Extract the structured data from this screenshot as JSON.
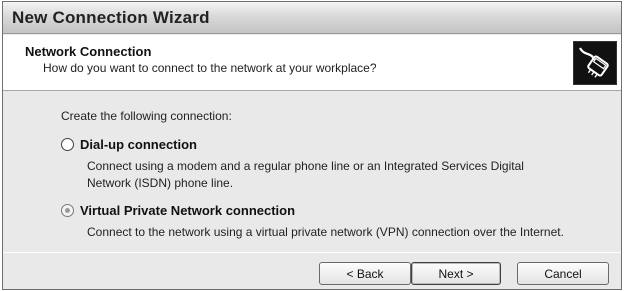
{
  "window": {
    "title": "New Connection Wizard"
  },
  "header": {
    "title": "Network Connection",
    "subtitle": "How do you want to connect to the network at your workplace?",
    "icon": "network-cable-icon"
  },
  "content": {
    "prompt": "Create the following connection:",
    "options": [
      {
        "label": "Dial-up connection",
        "description_line1": "Connect using a modem and a regular phone line or an Integrated Services Digital",
        "description_line2": "Network (ISDN) phone line.",
        "selected": false
      },
      {
        "label": "Virtual Private Network connection",
        "description_line1": "Connect to the network using a virtual private network (VPN) connection over the Internet.",
        "selected": true
      }
    ]
  },
  "buttons": {
    "back": "< Back",
    "next": "Next >",
    "cancel": "Cancel"
  }
}
